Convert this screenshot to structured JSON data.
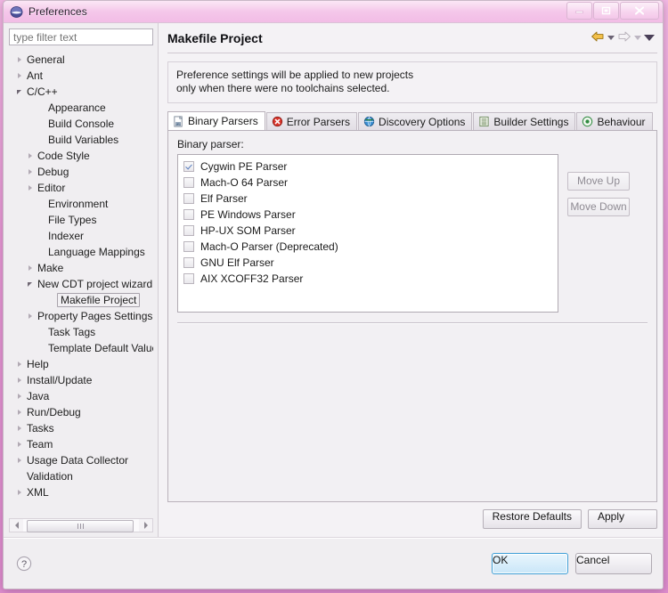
{
  "window": {
    "title": "Preferences",
    "icon": "eclipse-globe-icon",
    "minimize_label": "–",
    "restore_label": "❐",
    "close_label": "✕"
  },
  "sidebar": {
    "filter_placeholder": "type filter text",
    "items": [
      {
        "label": "General",
        "depth": 0,
        "twisty": "collapsed",
        "selected": false
      },
      {
        "label": "Ant",
        "depth": 0,
        "twisty": "collapsed",
        "selected": false
      },
      {
        "label": "C/C++",
        "depth": 0,
        "twisty": "expanded",
        "selected": false
      },
      {
        "label": "Appearance",
        "depth": 2,
        "twisty": "none",
        "selected": false
      },
      {
        "label": "Build Console",
        "depth": 2,
        "twisty": "none",
        "selected": false
      },
      {
        "label": "Build Variables",
        "depth": 2,
        "twisty": "none",
        "selected": false
      },
      {
        "label": "Code Style",
        "depth": 1,
        "twisty": "collapsed",
        "selected": false
      },
      {
        "label": "Debug",
        "depth": 1,
        "twisty": "collapsed",
        "selected": false
      },
      {
        "label": "Editor",
        "depth": 1,
        "twisty": "collapsed",
        "selected": false
      },
      {
        "label": "Environment",
        "depth": 2,
        "twisty": "none",
        "selected": false
      },
      {
        "label": "File Types",
        "depth": 2,
        "twisty": "none",
        "selected": false
      },
      {
        "label": "Indexer",
        "depth": 2,
        "twisty": "none",
        "selected": false
      },
      {
        "label": "Language Mappings",
        "depth": 2,
        "twisty": "none",
        "selected": false
      },
      {
        "label": "Make",
        "depth": 1,
        "twisty": "collapsed",
        "selected": false
      },
      {
        "label": "New CDT project wizard",
        "depth": 1,
        "twisty": "expanded",
        "selected": false
      },
      {
        "label": "Makefile Project",
        "depth": 3,
        "twisty": "none",
        "selected": true
      },
      {
        "label": "Property Pages Settings",
        "depth": 1,
        "twisty": "collapsed",
        "selected": false
      },
      {
        "label": "Task Tags",
        "depth": 2,
        "twisty": "none",
        "selected": false
      },
      {
        "label": "Template Default Value",
        "depth": 2,
        "twisty": "none",
        "selected": false
      },
      {
        "label": "Help",
        "depth": 0,
        "twisty": "collapsed",
        "selected": false
      },
      {
        "label": "Install/Update",
        "depth": 0,
        "twisty": "collapsed",
        "selected": false
      },
      {
        "label": "Java",
        "depth": 0,
        "twisty": "collapsed",
        "selected": false
      },
      {
        "label": "Run/Debug",
        "depth": 0,
        "twisty": "collapsed",
        "selected": false
      },
      {
        "label": "Tasks",
        "depth": 0,
        "twisty": "collapsed",
        "selected": false
      },
      {
        "label": "Team",
        "depth": 0,
        "twisty": "collapsed",
        "selected": false
      },
      {
        "label": "Usage Data Collector",
        "depth": 0,
        "twisty": "collapsed",
        "selected": false
      },
      {
        "label": "Validation",
        "depth": 0,
        "twisty": "none",
        "selected": false
      },
      {
        "label": "XML",
        "depth": 0,
        "twisty": "collapsed",
        "selected": false
      }
    ]
  },
  "page": {
    "title": "Makefile Project",
    "nav": {
      "back_icon": "back-arrow-icon",
      "back_menu_icon": "chevron-down-icon",
      "forward_icon": "forward-arrow-icon",
      "forward_menu_icon": "chevron-down-icon",
      "menu_icon": "chevron-down-icon"
    },
    "info_line_1": "Preference settings will be applied to new projects",
    "info_line_2": "only when there were no toolchains selected.",
    "tabs": [
      {
        "label": "Binary Parsers",
        "icon": "binary-file-icon",
        "active": true
      },
      {
        "label": "Error Parsers",
        "icon": "error-icon",
        "active": false
      },
      {
        "label": "Discovery Options",
        "icon": "globe-icon",
        "active": false
      },
      {
        "label": "Builder Settings",
        "icon": "list-icon",
        "active": false
      },
      {
        "label": "Behaviour",
        "icon": "radio-target-icon",
        "active": false
      }
    ],
    "parser_group_label": "Binary parser:",
    "parsers": [
      {
        "label": "Cygwin PE Parser",
        "checked": true
      },
      {
        "label": "Mach-O 64 Parser",
        "checked": false
      },
      {
        "label": "Elf Parser",
        "checked": false
      },
      {
        "label": "PE Windows Parser",
        "checked": false
      },
      {
        "label": "HP-UX SOM Parser",
        "checked": false
      },
      {
        "label": "Mach-O Parser (Deprecated)",
        "checked": false
      },
      {
        "label": "GNU Elf Parser",
        "checked": false
      },
      {
        "label": "AIX XCOFF32 Parser",
        "checked": false
      }
    ],
    "move_up_label": "Move Up",
    "move_down_label": "Move Down",
    "restore_defaults_label": "Restore Defaults",
    "apply_label": "Apply"
  },
  "footer": {
    "help_icon": "help-question-icon",
    "ok_label": "OK",
    "cancel_label": "Cancel"
  },
  "colors": {
    "accent_default_button": "#3d9ed6",
    "back_arrow": "#e8b53d",
    "checkbox_check": "#5a7fbf",
    "desktop": "#e89ad6"
  }
}
